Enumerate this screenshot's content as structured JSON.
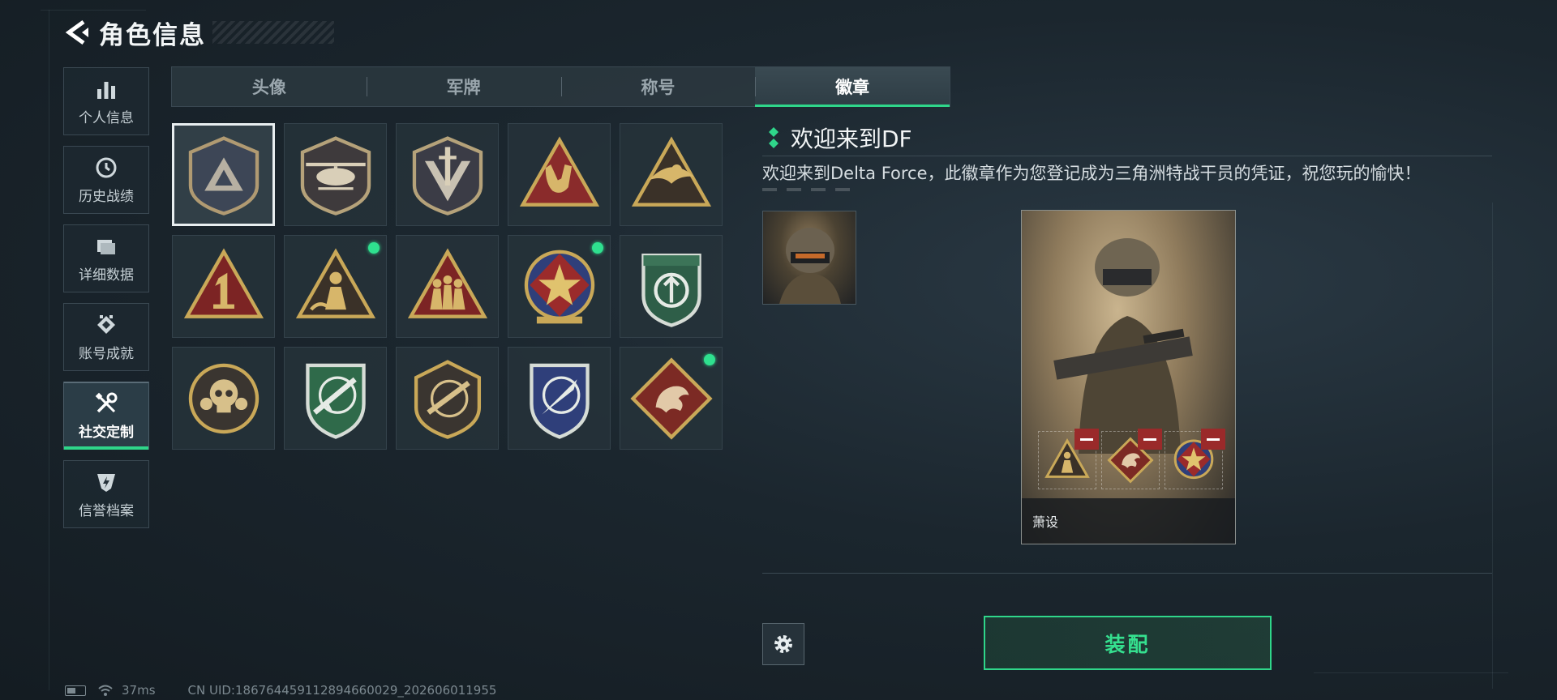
{
  "header": {
    "title": "角色信息"
  },
  "sidebar": {
    "items": [
      {
        "label": "个人信息",
        "icon": "bar-chart-icon"
      },
      {
        "label": "历史战绩",
        "icon": "clock-icon"
      },
      {
        "label": "详细数据",
        "icon": "folder-icon"
      },
      {
        "label": "账号成就",
        "icon": "achievement-icon"
      },
      {
        "label": "社交定制",
        "icon": "tools-icon",
        "active": true
      },
      {
        "label": "信誉档案",
        "icon": "credit-shield-icon"
      }
    ]
  },
  "tabs": [
    {
      "label": "头像"
    },
    {
      "label": "军牌"
    },
    {
      "label": "称号"
    },
    {
      "label": "徽章",
      "active": true
    }
  ],
  "badges": [
    {
      "name": "delta-triangle-shield-badge",
      "selected": true,
      "new": false
    },
    {
      "name": "helicopter-badge",
      "new": false
    },
    {
      "name": "dagger-shield-badge",
      "new": false
    },
    {
      "name": "rock-hand-triangle-badge",
      "new": false
    },
    {
      "name": "bird-triangle-badge",
      "new": false
    },
    {
      "name": "number-one-triangle-badge",
      "new": false
    },
    {
      "name": "soldier-triangle-badge",
      "new": true
    },
    {
      "name": "squad-triangle-badge",
      "new": false
    },
    {
      "name": "star-medal-badge",
      "new": true
    },
    {
      "name": "green-shield-badge",
      "new": false
    },
    {
      "name": "skull-round-badge",
      "new": false
    },
    {
      "name": "rifle-green-shield-badge",
      "new": false
    },
    {
      "name": "rifle-round-badge",
      "new": false
    },
    {
      "name": "knife-blue-shield-badge",
      "new": false
    },
    {
      "name": "dragon-diamond-badge",
      "new": true
    }
  ],
  "detail": {
    "name": "欢迎来到DF",
    "description": "欢迎来到Delta Force，此徽章作为您登记成为三角洲特战干员的凭证，祝您玩的愉快！"
  },
  "card": {
    "operator_name": "萧设"
  },
  "actions": {
    "equip_label": "装配"
  },
  "status": {
    "ping": "37ms",
    "uid": "CN UID:18676445911289466002­9_202606011955"
  },
  "colors": {
    "accent": "#2fd68a",
    "new_dot": "#2fe08f",
    "remove": "#9a2a2a"
  }
}
